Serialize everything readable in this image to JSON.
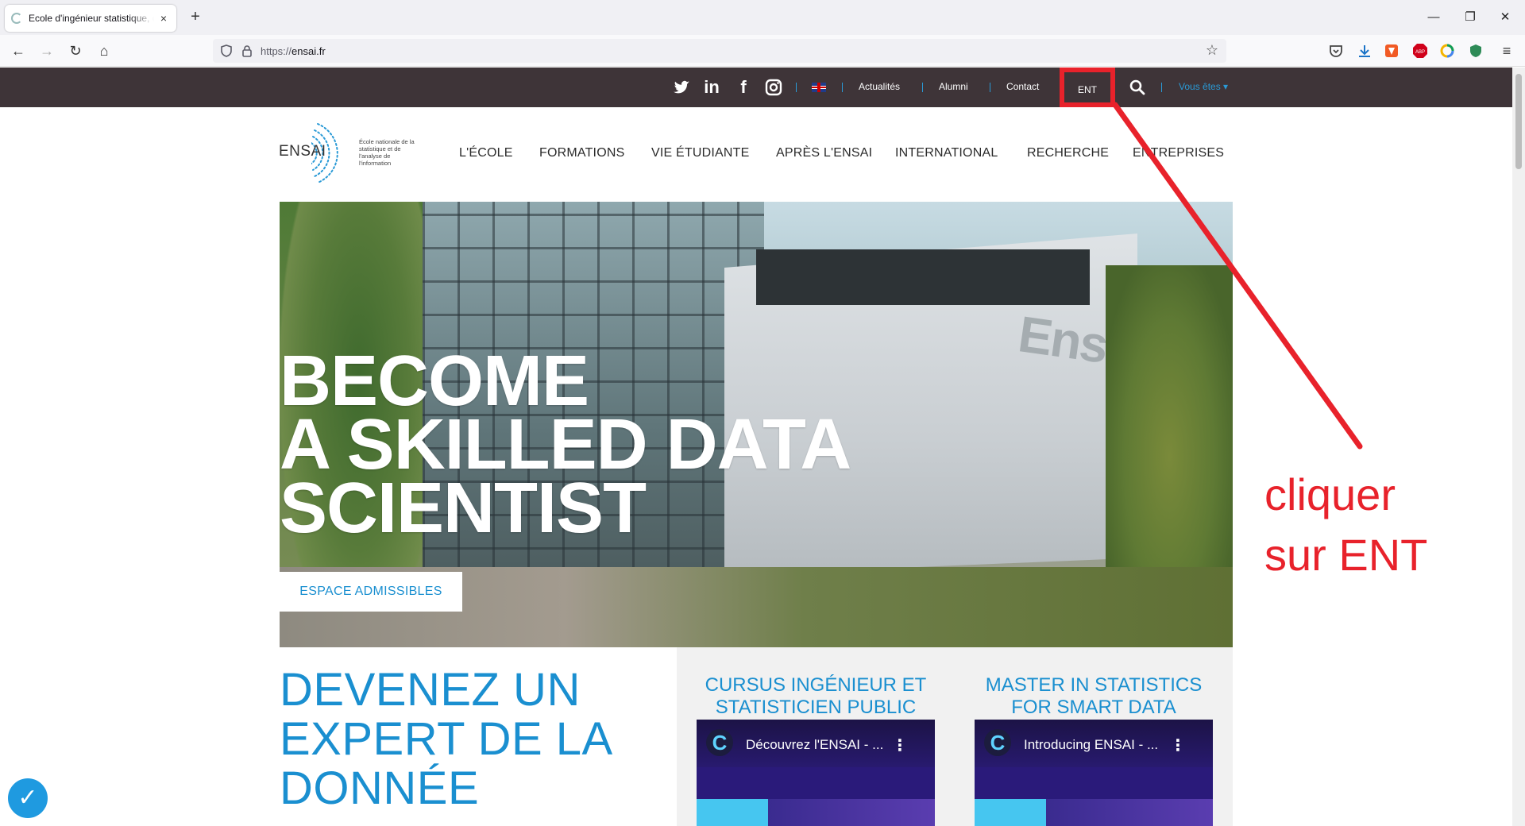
{
  "browser": {
    "tab_title": "Ecole d'ingénieur statistique, da",
    "url_prefix": "https://",
    "url_host": "ensai.fr",
    "new_tab": "+",
    "close_tab": "×"
  },
  "site": {
    "topbar": {
      "links": [
        "Actualités",
        "Alumni",
        "Contact"
      ],
      "ent_label": "ENT",
      "vous_etes": "Vous êtes ▾"
    },
    "logo": {
      "word": "ENSAI",
      "subtitle": "École nationale de la statistique et de l'analyse de l'information"
    },
    "nav": [
      "L'ÉCOLE",
      "FORMATIONS",
      "VIE ÉTUDIANTE",
      "APRÈS L'ENSAI",
      "INTERNATIONAL",
      "RECHERCHE",
      "ENTREPRISES"
    ],
    "hero": {
      "headline": [
        "BECOME",
        "A SKILLED DATA",
        "SCIENTIST"
      ],
      "cta": "ESPACE ADMISSIBLES",
      "wall_text": "Ensai"
    },
    "lower": {
      "big_title": [
        "DEVENEZ UN",
        "EXPERT DE LA",
        "DONNÉE"
      ],
      "cards": [
        {
          "title": [
            "CURSUS INGÉNIEUR ET",
            "STATISTICIEN PUBLIC"
          ],
          "video_title": "Découvrez l'ENSAI - ..."
        },
        {
          "title": [
            "MASTER IN STATISTICS",
            "FOR SMART DATA"
          ],
          "video_title": "Introducing ENSAI - ..."
        }
      ]
    }
  },
  "annotation": {
    "text": [
      "cliquer",
      "sur ENT"
    ],
    "color": "#e8222b"
  },
  "colors": {
    "topbar_bg": "#3e3438",
    "brand_blue": "#1a8fd0",
    "annotation_red": "#e8222b"
  }
}
